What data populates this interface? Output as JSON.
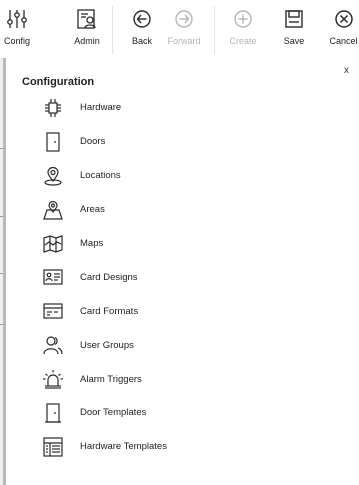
{
  "toolbar": {
    "buttons": [
      {
        "label": "Config",
        "icon": "config-sliders-icon",
        "enabled": true
      },
      {
        "label": "Admin",
        "icon": "admin-icon",
        "enabled": true
      },
      {
        "label": "Back",
        "icon": "back-arrow-icon",
        "enabled": true
      },
      {
        "label": "Forward",
        "icon": "forward-arrow-icon",
        "enabled": false
      },
      {
        "label": "Create",
        "icon": "create-plus-icon",
        "enabled": false
      },
      {
        "label": "Save",
        "icon": "save-icon",
        "enabled": true
      },
      {
        "label": "Cancel",
        "icon": "cancel-icon",
        "enabled": true
      }
    ]
  },
  "panel": {
    "close_label": "x",
    "title": "Configuration",
    "items": [
      {
        "label": "Hardware",
        "icon": "hardware-chip-icon"
      },
      {
        "label": "Doors",
        "icon": "door-icon"
      },
      {
        "label": "Locations",
        "icon": "location-pin-icon"
      },
      {
        "label": "Areas",
        "icon": "area-map-pin-icon"
      },
      {
        "label": "Maps",
        "icon": "map-icon"
      },
      {
        "label": "Card Designs",
        "icon": "card-design-icon"
      },
      {
        "label": "Card Formats",
        "icon": "card-format-icon"
      },
      {
        "label": "User Groups",
        "icon": "user-group-icon"
      },
      {
        "label": "Alarm Triggers",
        "icon": "alarm-icon"
      },
      {
        "label": "Door Templates",
        "icon": "door-template-icon"
      },
      {
        "label": "Hardware Templates",
        "icon": "hardware-template-icon"
      }
    ]
  },
  "colors": {
    "icon": "#2b2b2b",
    "disabled": "#b5b5b5",
    "left_bar": "#b9b9b9"
  }
}
